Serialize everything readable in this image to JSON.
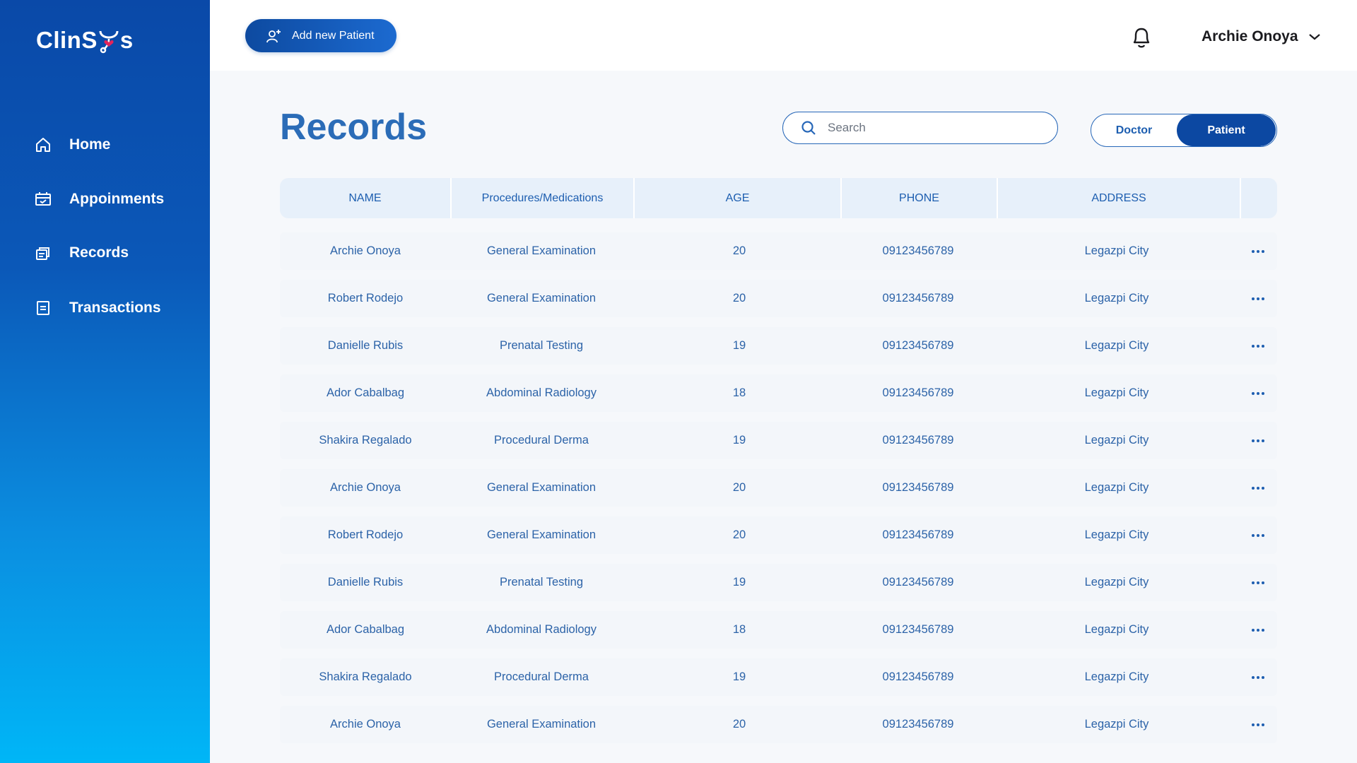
{
  "app": {
    "logo_text_left": "ClinS",
    "logo_text_right": "s"
  },
  "sidebar": {
    "items": [
      {
        "label": "Home",
        "icon": "home-icon"
      },
      {
        "label": "Appoinments",
        "icon": "calendar-icon"
      },
      {
        "label": "Records",
        "icon": "records-icon"
      },
      {
        "label": "Transactions",
        "icon": "document-icon"
      }
    ]
  },
  "topbar": {
    "add_button_label": "Add new Patient",
    "user_name": "Archie Onoya"
  },
  "main": {
    "title": "Records",
    "search_placeholder": "Search",
    "toggle": {
      "doctor": "Doctor",
      "patient": "Patient",
      "selected": "Patient"
    }
  },
  "table": {
    "columns": [
      "NAME",
      "Procedures/Medications",
      "AGE",
      "PHONE",
      "ADDRESS"
    ],
    "rows": [
      [
        "Archie Onoya",
        "General Examination",
        "20",
        "09123456789",
        "Legazpi City"
      ],
      [
        "Robert Rodejo",
        "General Examination",
        "20",
        "09123456789",
        "Legazpi City"
      ],
      [
        "Danielle Rubis",
        "Prenatal Testing",
        "19",
        "09123456789",
        "Legazpi City"
      ],
      [
        "Ador Cabalbag",
        "Abdominal Radiology",
        "18",
        "09123456789",
        "Legazpi City"
      ],
      [
        "Shakira Regalado",
        "Procedural Derma",
        "19",
        "09123456789",
        "Legazpi City"
      ],
      [
        "Archie Onoya",
        "General Examination",
        "20",
        "09123456789",
        "Legazpi City"
      ],
      [
        "Robert Rodejo",
        "General Examination",
        "20",
        "09123456789",
        "Legazpi City"
      ],
      [
        "Danielle Rubis",
        "Prenatal Testing",
        "19",
        "09123456789",
        "Legazpi City"
      ],
      [
        "Ador Cabalbag",
        "Abdominal Radiology",
        "18",
        "09123456789",
        "Legazpi City"
      ],
      [
        "Shakira Regalado",
        "Procedural Derma",
        "19",
        "09123456789",
        "Legazpi City"
      ],
      [
        "Archie Onoya",
        "General Examination",
        "20",
        "09123456789",
        "Legazpi City"
      ]
    ]
  },
  "colors": {
    "sidebar_top": "#0a49a8",
    "sidebar_bottom": "#00b6f7",
    "accent": "#0c48a2",
    "title": "#2b6cb7",
    "table_text": "#2c63a8",
    "heart": "#e2245b"
  }
}
